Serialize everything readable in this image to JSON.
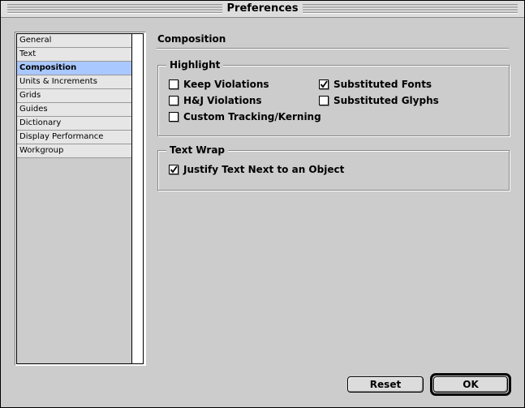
{
  "window": {
    "title": "Preferences"
  },
  "sidebar": {
    "items": [
      {
        "label": "General",
        "selected": false
      },
      {
        "label": "Text",
        "selected": false
      },
      {
        "label": "Composition",
        "selected": true
      },
      {
        "label": "Units & Increments",
        "selected": false
      },
      {
        "label": "Grids",
        "selected": false
      },
      {
        "label": "Guides",
        "selected": false
      },
      {
        "label": "Dictionary",
        "selected": false
      },
      {
        "label": "Display Performance",
        "selected": false
      },
      {
        "label": "Workgroup",
        "selected": false
      }
    ]
  },
  "main": {
    "title": "Composition",
    "highlight": {
      "label": "Highlight",
      "options": {
        "keep_violations": {
          "label": "Keep Violations",
          "checked": false
        },
        "hj_violations": {
          "label": "H&J Violations",
          "checked": false
        },
        "custom_tracking": {
          "label": "Custom Tracking/Kerning",
          "checked": false
        },
        "substituted_fonts": {
          "label": "Substituted Fonts",
          "checked": true
        },
        "substituted_glyphs": {
          "label": "Substituted Glyphs",
          "checked": false
        }
      }
    },
    "text_wrap": {
      "label": "Text Wrap",
      "options": {
        "justify_text": {
          "label": "Justify Text Next to an Object",
          "checked": true
        }
      }
    }
  },
  "buttons": {
    "reset": "Reset",
    "ok": "OK"
  }
}
